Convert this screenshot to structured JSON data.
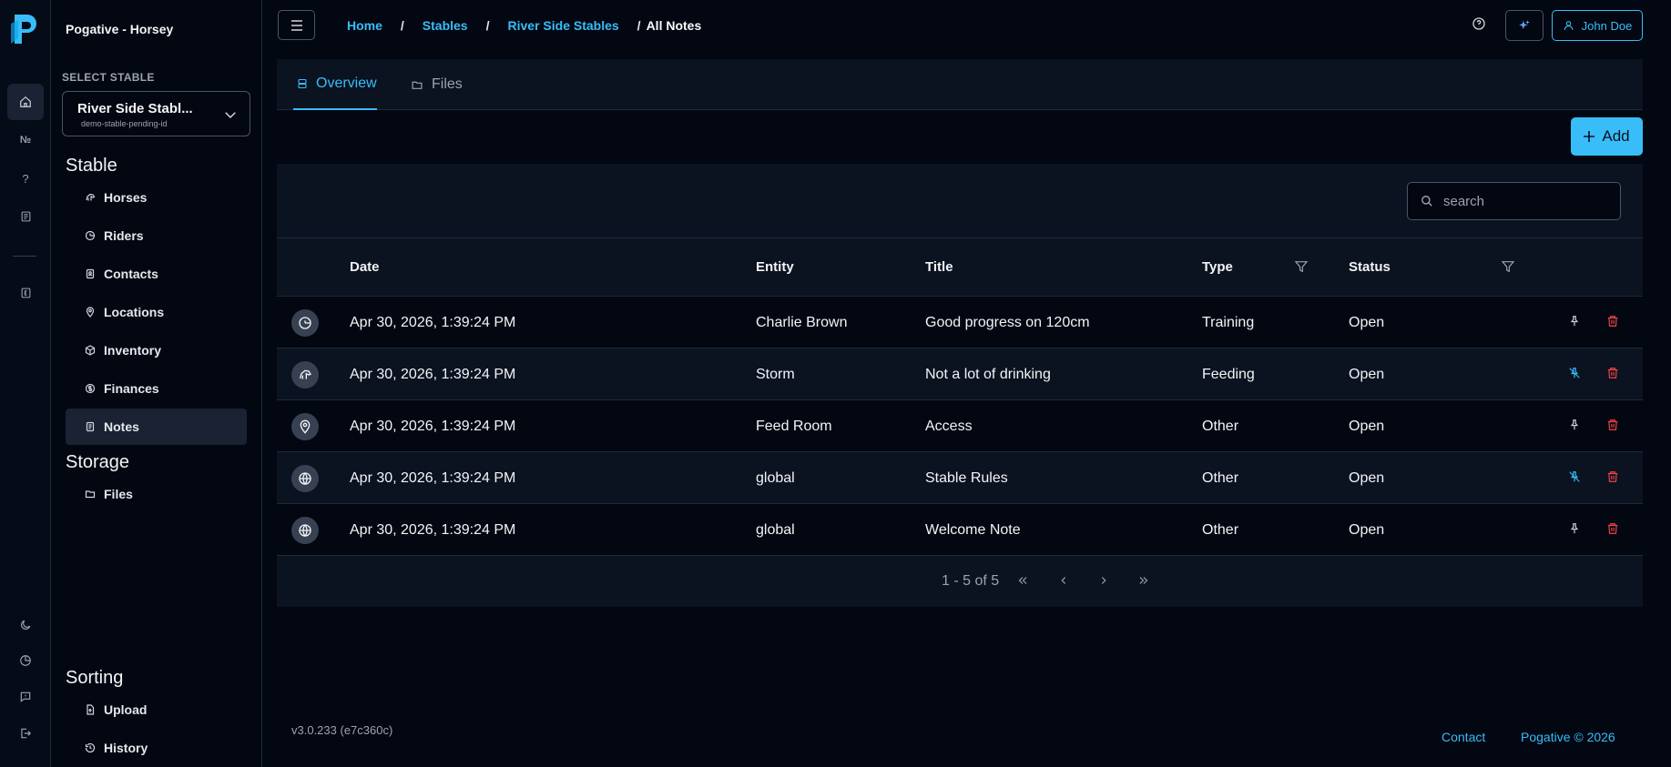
{
  "app": {
    "brand": "Pogative - Horsey"
  },
  "rail": {
    "items": [
      {
        "name": "home-icon"
      },
      {
        "name": "numero-icon",
        "text": "№"
      },
      {
        "name": "help-icon",
        "text": "?"
      },
      {
        "name": "list-icon"
      },
      {
        "name": "ledger-icon"
      }
    ],
    "bottom": [
      {
        "name": "moon-icon"
      },
      {
        "name": "chart-icon"
      },
      {
        "name": "message-icon"
      },
      {
        "name": "logout-icon"
      }
    ]
  },
  "sidebar": {
    "select_label": "SELECT STABLE",
    "selected_stable": "River Side Stabl...",
    "selected_stable_id": "demo-stable-pending-id",
    "sections": [
      {
        "title": "Stable",
        "items": [
          {
            "label": "Horses",
            "icon": "horse-icon"
          },
          {
            "label": "Riders",
            "icon": "helmet-icon"
          },
          {
            "label": "Contacts",
            "icon": "contact-book-icon"
          },
          {
            "label": "Locations",
            "icon": "map-pin-icon"
          },
          {
            "label": "Inventory",
            "icon": "box-icon"
          },
          {
            "label": "Finances",
            "icon": "coin-icon"
          },
          {
            "label": "Notes",
            "icon": "note-icon",
            "active": true
          }
        ]
      },
      {
        "title": "Storage",
        "items": [
          {
            "label": "Files",
            "icon": "folder-icon"
          }
        ]
      },
      {
        "title": "Sorting",
        "items": [
          {
            "label": "Upload",
            "icon": "file-upload-icon"
          },
          {
            "label": "History",
            "icon": "history-icon"
          }
        ]
      }
    ]
  },
  "header": {
    "breadcrumb": [
      "Home",
      "Stables",
      "River Side Stables",
      "All Notes"
    ],
    "separator": "/",
    "user": "John Doe"
  },
  "tabs": [
    {
      "label": "Overview",
      "icon": "list-rows-icon",
      "active": true
    },
    {
      "label": "Files",
      "icon": "folder-icon",
      "active": false
    }
  ],
  "actions": {
    "add_label": "Add"
  },
  "search": {
    "placeholder": "search"
  },
  "table": {
    "columns": [
      "Date",
      "Entity",
      "Title",
      "Type",
      "Status"
    ],
    "rows": [
      {
        "entity_icon": "helmet-icon",
        "date": "Apr 30, 2026, 1:39:24 PM",
        "entity": "Charlie Brown",
        "title": "Good progress on 120cm",
        "type": "Training",
        "status": "Open",
        "pinned": false
      },
      {
        "entity_icon": "horse-icon",
        "date": "Apr 30, 2026, 1:39:24 PM",
        "entity": "Storm",
        "title": "Not a lot of drinking",
        "type": "Feeding",
        "status": "Open",
        "pinned": true
      },
      {
        "entity_icon": "map-pin-icon",
        "date": "Apr 30, 2026, 1:39:24 PM",
        "entity": "Feed Room",
        "title": "Access",
        "type": "Other",
        "status": "Open",
        "pinned": false
      },
      {
        "entity_icon": "globe-icon",
        "date": "Apr 30, 2026, 1:39:24 PM",
        "entity": "global",
        "title": "Stable Rules",
        "type": "Other",
        "status": "Open",
        "pinned": true
      },
      {
        "entity_icon": "globe-icon",
        "date": "Apr 30, 2026, 1:39:24 PM",
        "entity": "global",
        "title": "Welcome Note",
        "type": "Other",
        "status": "Open",
        "pinned": false
      }
    ],
    "pagination": "1 - 5 of 5"
  },
  "footer": {
    "version": "v3.0.233 (e7c360c)",
    "contact": "Contact",
    "copyright": "Pogative © 2026"
  },
  "colors": {
    "accent": "#38bdf8",
    "background": "#030712",
    "panel": "#0b1220",
    "danger": "#ef4444"
  }
}
